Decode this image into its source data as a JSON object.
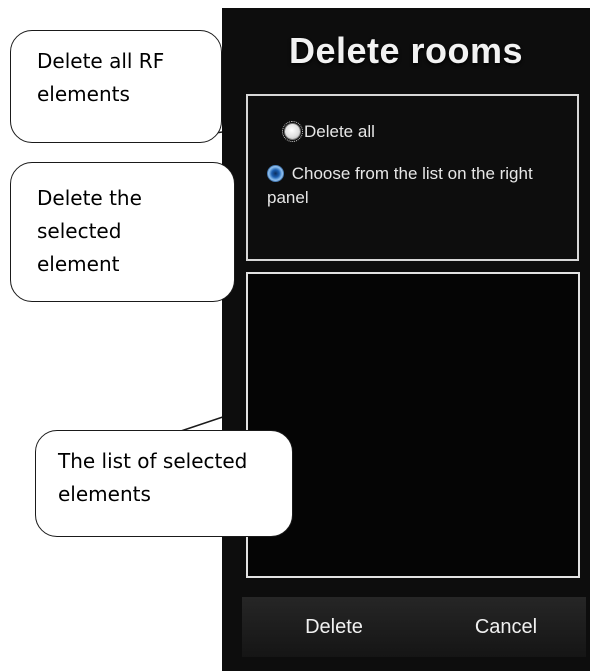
{
  "dialog": {
    "title": "Delete rooms",
    "option_delete_all": "Delete all",
    "option_choose_from_list": "Choose from the list on the right panel",
    "selected_option": "option_choose_from_list",
    "list_items": [],
    "delete_button": "Delete",
    "cancel_button": "Cancel"
  },
  "callouts": {
    "delete_all_rf": "Delete all RF\nelements",
    "delete_selected": "Delete the\nselected\nelement",
    "list_selected": "The list of selected\nelements"
  },
  "colors": {
    "panel_background": "#0d0d0d",
    "border": "#d7d7d7",
    "selected_radio": "#1c5fb0"
  }
}
